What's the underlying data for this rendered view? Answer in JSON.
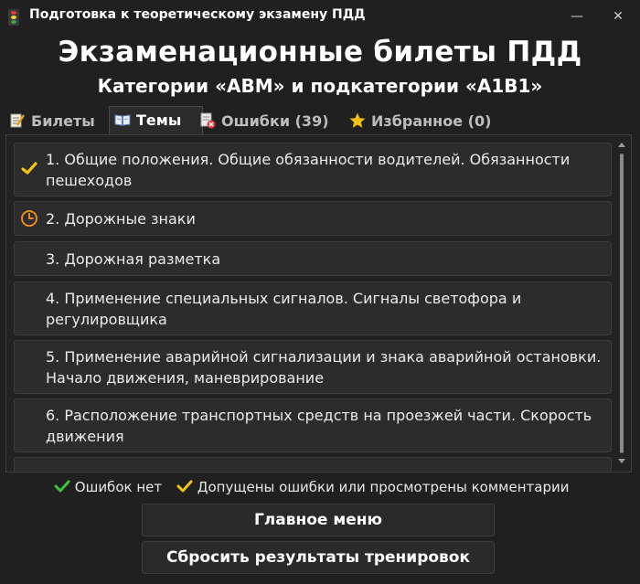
{
  "window": {
    "title": "Подготовка к теоретическому экзамену ПДД",
    "minimize": "—",
    "close": "✕"
  },
  "header": {
    "title": "Экзаменационные билеты ПДД",
    "subtitle": "Категории «ABM» и подкатегории «A1B1»"
  },
  "tabs": [
    {
      "label": "Билеты",
      "icon": "notepad-pencil-icon"
    },
    {
      "label": "Темы",
      "icon": "open-book-icon"
    },
    {
      "label": "Ошибки (39)",
      "icon": "error-document-icon"
    },
    {
      "label": "Избранное (0)",
      "icon": "star-icon"
    }
  ],
  "topics": [
    {
      "text": "1. Общие положения. Общие обязанности водителей. Обязанности пешеходов",
      "status": "yellow-check"
    },
    {
      "text": "2. Дорожные знаки",
      "status": "clock"
    },
    {
      "text": "3. Дорожная разметка",
      "status": "none"
    },
    {
      "text": "4. Применение специальных сигналов. Сигналы светофора и регулировщика",
      "status": "none"
    },
    {
      "text": "5. Применение аварийной сигнализации и знака аварийной остановки. Начало движения, маневрирование",
      "status": "none"
    },
    {
      "text": "6. Расположение транспортных средств на проезжей части. Скорость движения",
      "status": "none"
    }
  ],
  "legend": {
    "no_errors": "Ошибок нет",
    "errors": "Допущены ошибки или просмотрены комментарии"
  },
  "buttons": {
    "main_menu": "Главное меню",
    "reset": "Сбросить результаты тренировок"
  },
  "colors": {
    "background": "#202020",
    "green_check": "#3cc43c",
    "yellow_check": "#f3c318",
    "clock": "#e8891d"
  }
}
